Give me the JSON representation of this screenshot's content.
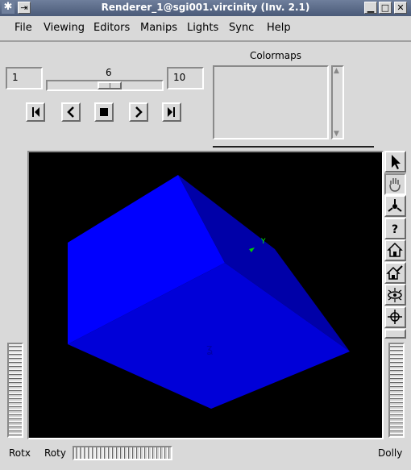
{
  "window": {
    "title": "Renderer_1@sgi001.vircinity (Inv. 2.1)"
  },
  "menubar": {
    "items": [
      "File",
      "Viewing",
      "Editors",
      "Manips",
      "Lights",
      "Sync",
      "Help"
    ]
  },
  "animation": {
    "min": "1",
    "current": "6",
    "max": "10",
    "slider_fraction": 0.55
  },
  "colormaps": {
    "label": "Colormaps"
  },
  "viewer": {
    "background": "#000000",
    "object_color": "#0000ff",
    "axis_label": "Y"
  },
  "thumbwheels": {
    "rotx_label": "Rotx",
    "roty_label": "Roty",
    "dolly_label": "Dolly"
  },
  "toolbar": {
    "icons": [
      "pick-arrow-icon",
      "view-hand-icon",
      "seek-icon",
      "help-icon",
      "home-icon",
      "set-home-icon",
      "view-all-icon",
      "center-icon"
    ]
  }
}
